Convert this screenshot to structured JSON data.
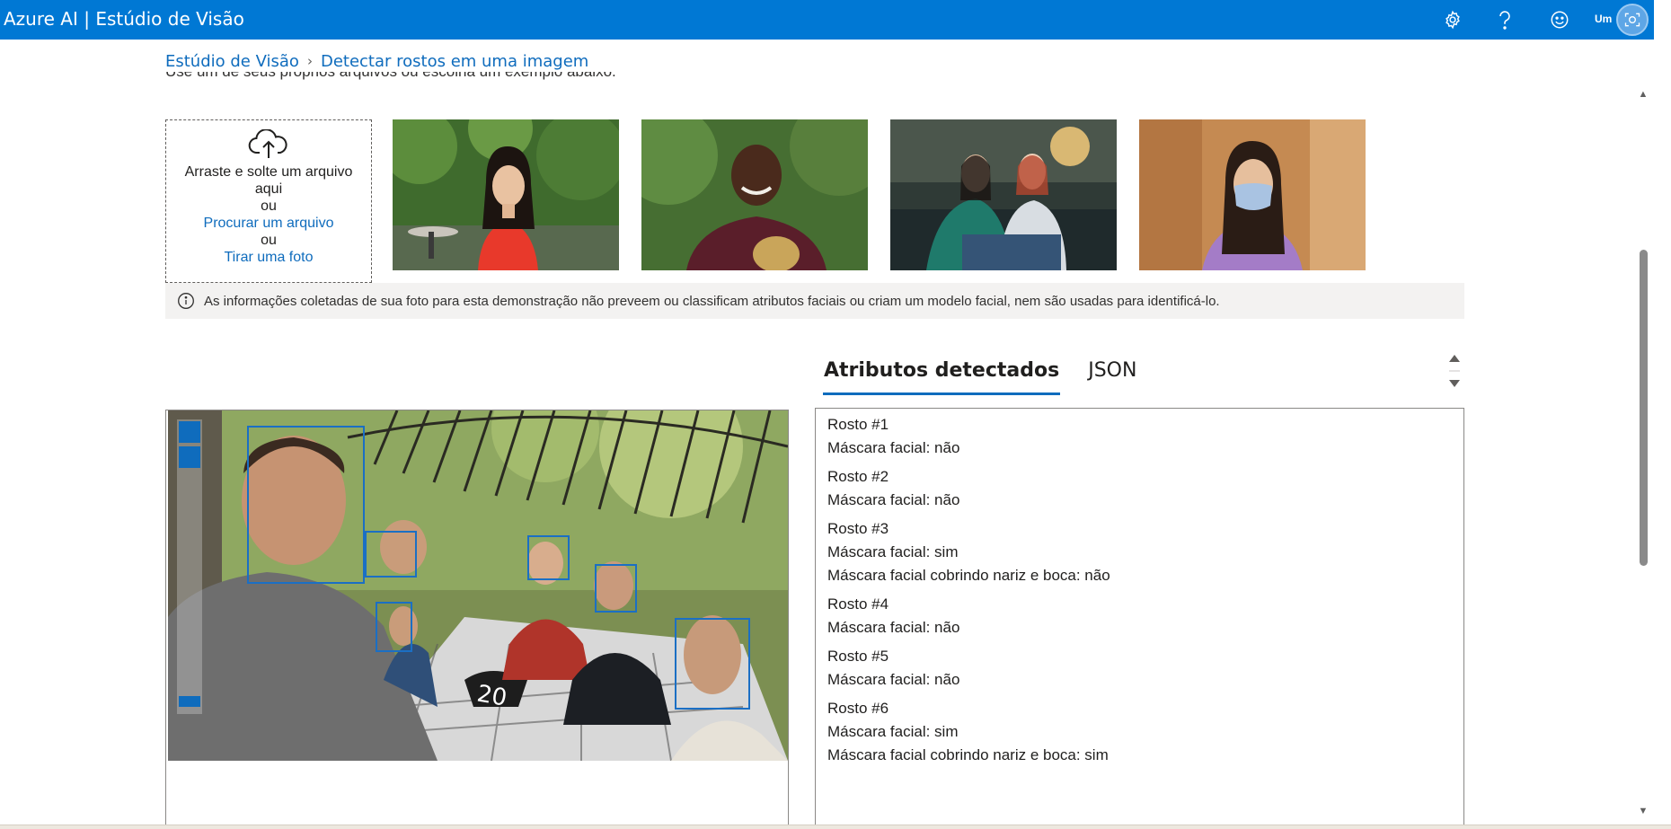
{
  "app": {
    "title": "Azure AI | Estúdio de Visão",
    "user_initials": "Um",
    "icons": [
      "gear-icon",
      "help-icon",
      "smiley-icon",
      "avatar-camera-icon"
    ]
  },
  "breadcrumb": {
    "root": "Estúdio de Visão",
    "separator": "›",
    "current": "Detectar rostos em uma imagem"
  },
  "intro_text": "Use um de seus próprios arquivos ou escolha um exemplo abaixo.",
  "upload": {
    "drag_text_1": "Arraste e solte um arquivo",
    "drag_text_2": "aqui",
    "or_1": "ou",
    "browse_link": "Procurar um arquivo",
    "or_2": "ou",
    "photo_link": "Tirar uma foto"
  },
  "samples": [
    "woman-red-blouse-photo",
    "man-with-bread-photo",
    "two-women-photo",
    "woman-face-mask-photo"
  ],
  "info_notice": "As informações coletadas de sua foto para esta demonstração não preveem ou classificam atributos faciais ou criam um modelo facial, nem são usadas para identificá-lo.",
  "tabs": {
    "attributes": "Atributos detectados",
    "json": "JSON"
  },
  "faces": [
    {
      "title": "Rosto #1",
      "mask": "Máscara facial: não",
      "cover": ""
    },
    {
      "title": "Rosto #2",
      "mask": "Máscara facial: não",
      "cover": ""
    },
    {
      "title": "Rosto #3",
      "mask": "Máscara facial: sim",
      "cover": "Máscara facial cobrindo nariz e boca: não"
    },
    {
      "title": "Rosto #4",
      "mask": "Máscara facial: não",
      "cover": ""
    },
    {
      "title": "Rosto #5",
      "mask": "Máscara facial: não",
      "cover": ""
    },
    {
      "title": "Rosto #6",
      "mask": "Máscara facial: sim",
      "cover": "Máscara facial cobrindo nariz e boca: sim"
    }
  ],
  "photo_table_number": "20",
  "colors": {
    "topbar": "#0078d4",
    "link": "#0f6cbd",
    "face_box": "#1b6fc4",
    "info_bg": "#f3f2f1"
  }
}
